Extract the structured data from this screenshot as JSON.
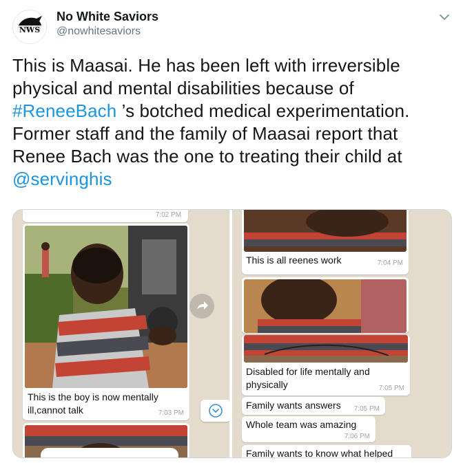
{
  "tweet": {
    "avatar_text": "NWS",
    "display_name": "No White Saviors",
    "handle": "@nowhitesaviors",
    "text_part1": "This is Maasai. He has been left with irreversible physical and mental disabilities because of ",
    "hashtag": "#ReneeBach",
    "text_part2": " ’s botched medical experimentation. Former staff and the family of Maasai report that Renee Bach was the one to treating their child at ",
    "mention": "@servinghis"
  },
  "colors": {
    "link": "#1b95e0",
    "chat_background": "#e4dbcd",
    "bubble": "#ffffff"
  },
  "chat_left": {
    "top_time": "7:02 PM",
    "caption": "This is the boy is now mentally ill,cannot talk",
    "caption_line1": "This is the boy is now mentally",
    "caption_line2": "ill,cannot talk",
    "caption_time": "7:03 PM",
    "forward_icon": "forward-arrow-icon",
    "scroll_icon": "chevron-down-circle-icon"
  },
  "chat_right": {
    "msg1": "This is all reenes work",
    "msg1_time": "7:04 PM",
    "msg2_line1": "Disabled for life mentally and",
    "msg2_line2": "physically",
    "msg2_time": "7:05 PM",
    "msg3": "Family wants answers",
    "msg3_time": "7:05 PM",
    "msg4": "Whole team was amazing",
    "msg4_time": "7:06 PM",
    "msg5": "Family wants to know what helped"
  }
}
